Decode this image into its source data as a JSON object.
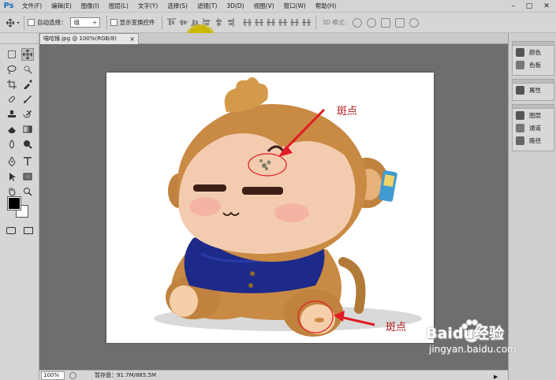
{
  "app": {
    "logo": "Ps"
  },
  "menu": [
    "文件(F)",
    "编辑(E)",
    "图像(I)",
    "图层(L)",
    "文字(Y)",
    "选择(S)",
    "滤镜(T)",
    "3D(D)",
    "视图(V)",
    "窗口(W)",
    "帮助(H)"
  ],
  "window_controls": {
    "minimize": "–",
    "restore": "□",
    "close": "✕"
  },
  "options": {
    "auto_select_label": "自动选择：",
    "auto_select_value": "组",
    "show_transform_label": "显示变换控件",
    "mode3d_label": "3D 模式："
  },
  "document_tab": {
    "title": "喵哈猴.jpg @ 100%(RGB/8)",
    "close": "×"
  },
  "status": {
    "zoom": "100%",
    "scratch": "暂存盘：91.7M/885.5M"
  },
  "right_panel": {
    "group1": [
      {
        "icon": "color-swatch-icon",
        "label": "颜色"
      },
      {
        "icon": "swatches-grid-icon",
        "label": "色板"
      }
    ],
    "group2": [
      {
        "icon": "properties-icon",
        "label": "属性"
      }
    ],
    "group3": [
      {
        "icon": "layers-icon",
        "label": "图层"
      },
      {
        "icon": "channels-icon",
        "label": "通道"
      },
      {
        "icon": "paths-icon",
        "label": "路径"
      }
    ]
  },
  "annotations": {
    "spot_label_1": "斑点",
    "spot_label_2": "斑点"
  },
  "watermark": {
    "brand": "Baidu经验",
    "url": "jingyan.baidu.com"
  },
  "colors": {
    "accent_red": "#e11b22",
    "canvas_bg": "#6e6e6e",
    "cursor_highlight": "#d4c200"
  }
}
